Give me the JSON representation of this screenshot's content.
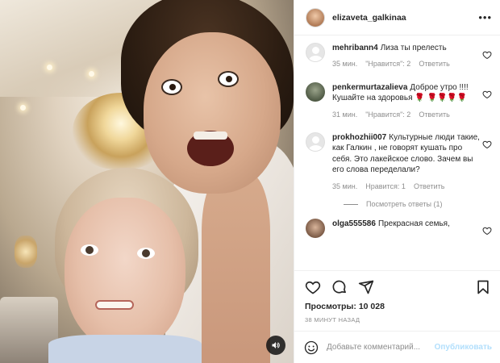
{
  "post": {
    "username": "elizaveta_galkinaa"
  },
  "comments": [
    {
      "username": "mehribann4",
      "text": "Лиза ты прелесть",
      "time": "35 мин.",
      "likes": "\"Нравится\": 2",
      "reply": "Ответить",
      "avatar": "blank"
    },
    {
      "username": "penkermurtazalieva",
      "text": "Доброе утро !!!! Кушайте на здоровья 🌹 🌹🌹🌹🌹",
      "time": "31 мин.",
      "likes": "\"Нравится\": 2",
      "reply": "Ответить",
      "avatar": "photo1"
    },
    {
      "username": "prokhozhii007",
      "text": "Культурные люди такие, как Галкин , не говорят кушать про себя. Это лакейское слово. Зачем вы его слова переделали?",
      "time": "35 мин.",
      "likes": "Нравится: 1",
      "reply": "Ответить",
      "avatar": "blank"
    },
    {
      "username": "olga555586",
      "text": "Прекрасная семья,",
      "avatar": "photo2"
    }
  ],
  "replies_link": "Посмотреть ответы (1)",
  "stats": {
    "views_label": "Просмотры:",
    "views_count": "10 028",
    "posted": "38 МИНУТ НАЗАД"
  },
  "add_comment": {
    "placeholder": "Добавьте комментарий...",
    "publish_label": "Опубликовать"
  },
  "icons": {
    "like": "heart-icon",
    "comment": "comment-icon",
    "share": "share-icon",
    "save": "bookmark-icon",
    "sound": "speaker-icon",
    "more": "more-options-icon",
    "emoji": "emoji-icon"
  }
}
